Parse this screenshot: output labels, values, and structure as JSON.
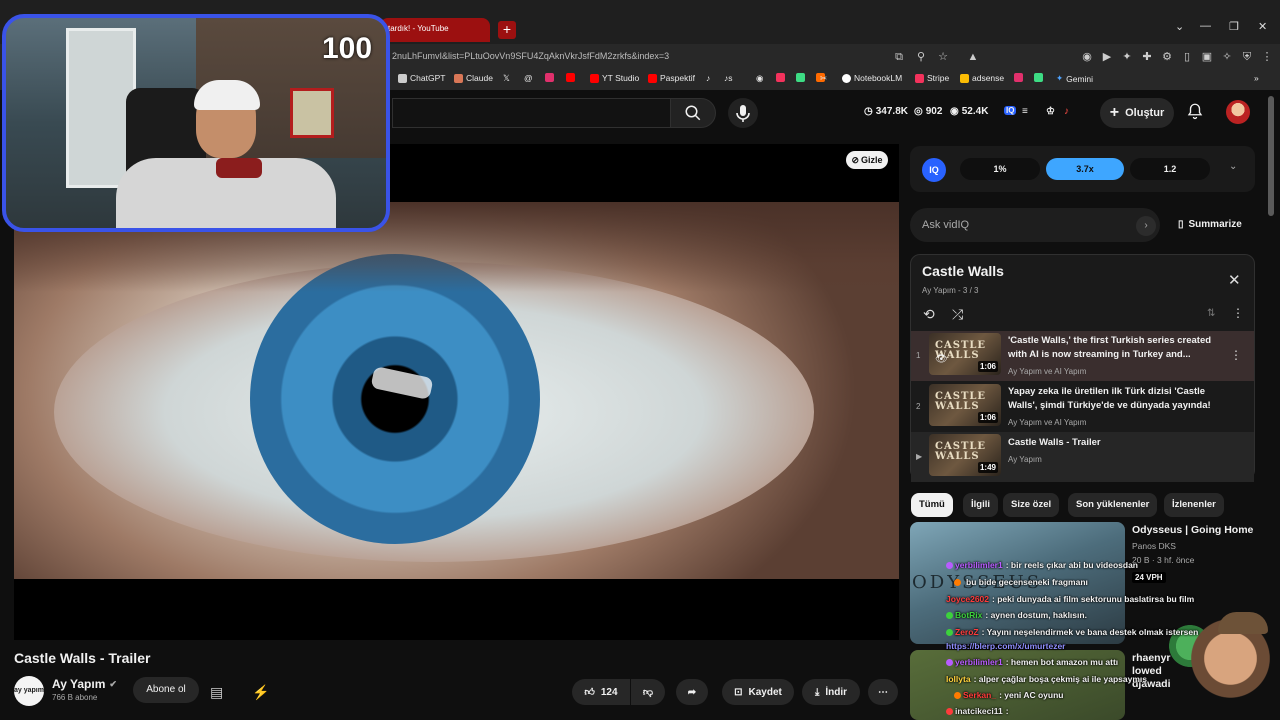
{
  "browser": {
    "tab_title": "tardık! - YouTube",
    "url": "2nuLhFumvI&list=PLtuOovVn9SFU4ZqAknVkrJsfFdM2zrkfs&index=3",
    "bookmarks": [
      "ChatGPT",
      "Claude",
      "YT Studio",
      "Paspektif",
      "NotebookLM",
      "Stripe",
      "adsense",
      "Gemini"
    ]
  },
  "header": {
    "stats": [
      "347.8K",
      "902",
      "52.4K"
    ],
    "create_label": "Oluştur"
  },
  "webcam": {
    "counter": "100"
  },
  "player": {
    "hide_label": "Gizle"
  },
  "video": {
    "title": "Castle Walls - Trailer",
    "channel": "Ay Yapım",
    "channel_avatar_text": "ay yapım",
    "subscribers": "766 B abone",
    "subscribe_label": "Abone ol",
    "likes": "124",
    "save_label": "Kaydet",
    "download_label": "İndir"
  },
  "vidiq": {
    "logo": "IQ",
    "chips": [
      "1%",
      "3.7x",
      "1.2"
    ],
    "ask_placeholder": "Ask vidIQ",
    "summarize_label": "Summarize"
  },
  "playlist": {
    "title": "Castle Walls",
    "subtitle": "Ay Yapım - 3 / 3",
    "items": [
      {
        "index": "1",
        "title": "'Castle Walls,' the first Turkish series created with AI is now streaming in Turkey and...",
        "channel": "Ay Yapım ve AI Yapım",
        "duration": "1:06",
        "thumb_text": "CASTLE WALLS"
      },
      {
        "index": "2",
        "title": "Yapay zeka ile üretilen ilk Türk dizisi 'Castle Walls', şimdi Türkiye'de ve dünyada yayında!",
        "channel": "Ay Yapım ve AI Yapım",
        "duration": "1:06",
        "thumb_text": "CASTLE WALLS"
      },
      {
        "index": "▶",
        "title": "Castle Walls - Trailer",
        "channel": "Ay Yapım",
        "duration": "1:49",
        "thumb_text": "CASTLE WALLS"
      }
    ]
  },
  "chips": [
    "Tümü",
    "İlgili",
    "Size özel",
    "Son yüklenenler",
    "İzlenenler"
  ],
  "recommendation": {
    "title": "Odysseus | Going Home",
    "channel": "Panos DKS",
    "meta": "20 B · 3 hf. önce",
    "thumb_text": "ODYSSEUS",
    "duration": "24 VPH",
    "second_channel_text": "rhaenyr lowed djawadi"
  },
  "chat": [
    {
      "user": "yerbilimler1",
      "msg": ": bir reels çıkar abi bu videosdan",
      "color": "#b85cff"
    },
    {
      "user": "",
      "msg": "bu bide gecenseneki fragmanı",
      "color": "#ff7b00"
    },
    {
      "user": "Joyce2602",
      "msg": ": peki dunyada ai film sektorunu baslatirsa bu film",
      "color": "#ff3b3b"
    },
    {
      "user": "BotRix",
      "msg": ": aynen dostum, haklısın.",
      "color": "#3cd23c"
    },
    {
      "user": "ZeroZ",
      "msg": ": Yayını neşelendirmek ve bana destek olmak istersen",
      "color": "#ff3b3b"
    },
    {
      "user": "",
      "msg": "https://blerp.com/x/umurtezer",
      "color": "#8f8fff"
    },
    {
      "user": "yerbilimler1",
      "msg": ": hemen bot amazon mu attı",
      "color": "#b85cff"
    },
    {
      "user": "lollyta",
      "msg": ": alper çağlar boşa çekmiş ai ile yapsaymış",
      "color": "#ffd23c"
    },
    {
      "user": "Serkan_",
      "msg": ": yeni AC oyunu",
      "color": "#ff3b3b"
    },
    {
      "user": "inatcikeci11",
      "msg": ":",
      "color": "#e8e8e8"
    }
  ],
  "colors": {
    "accent": "#3ea6ff",
    "vidiq_blue": "#2962ff",
    "webcam_border": "#3a53e8"
  }
}
